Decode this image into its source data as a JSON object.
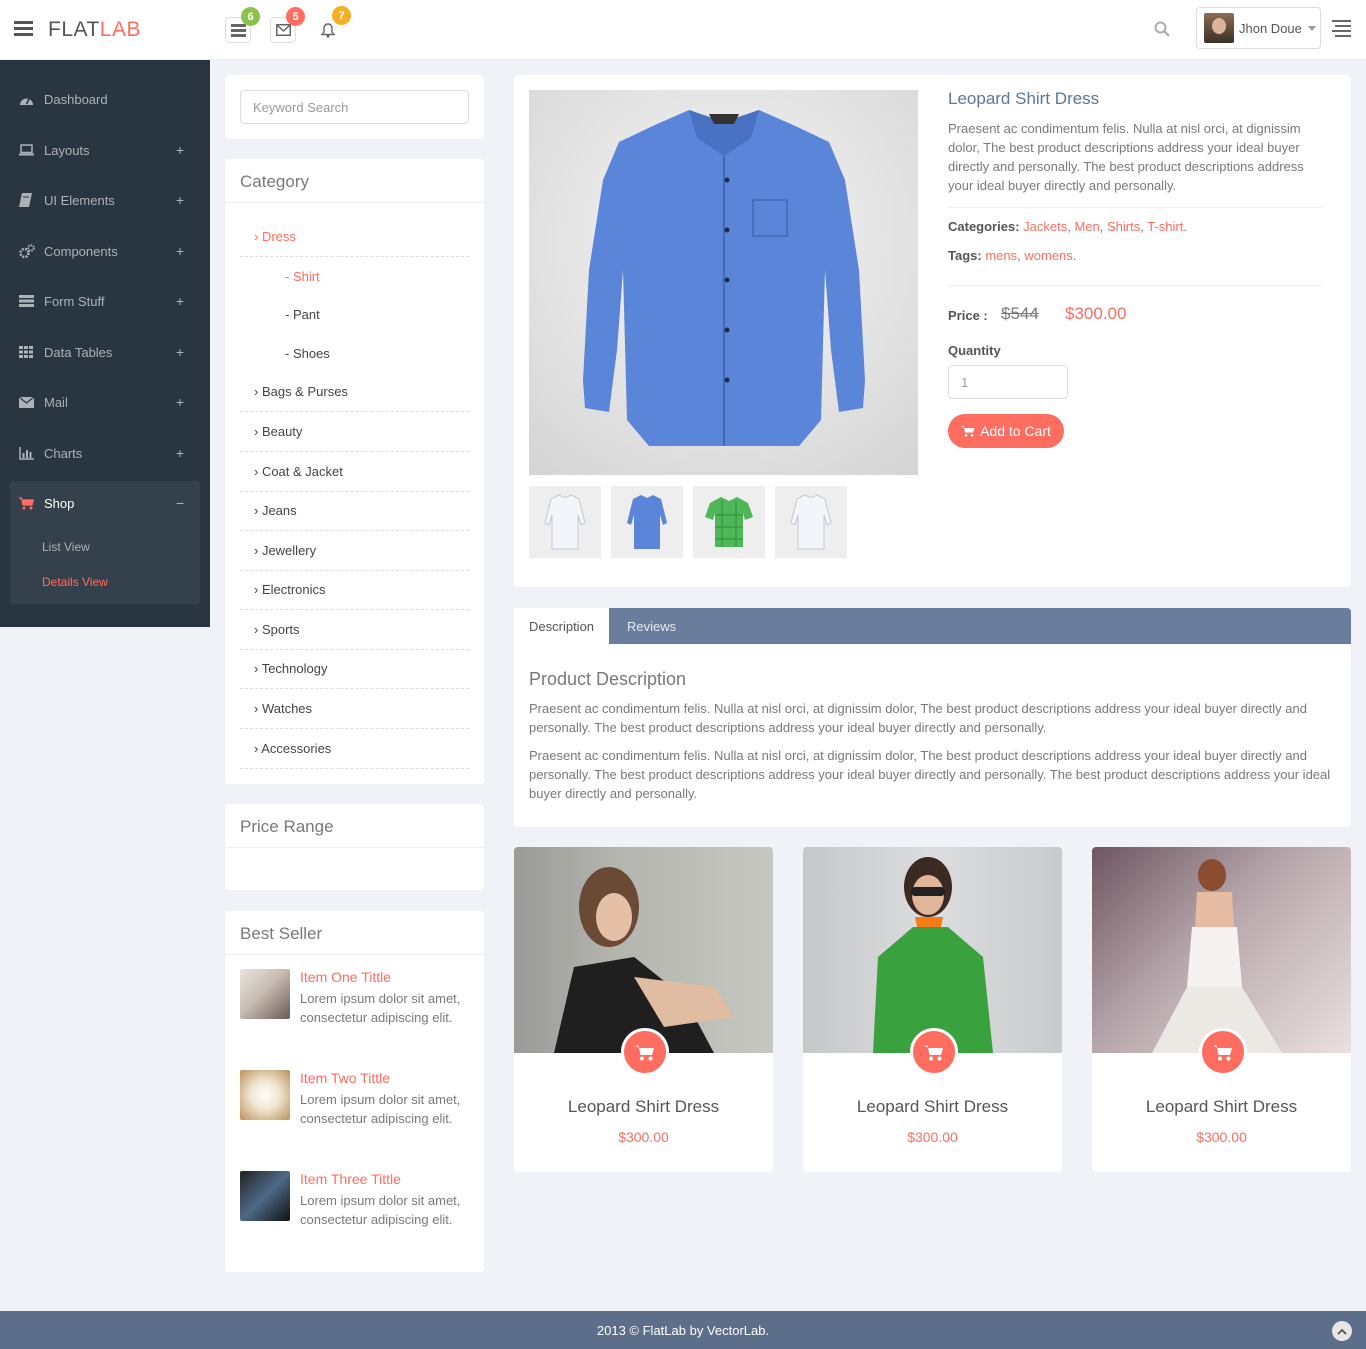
{
  "header": {
    "logo_main": "FLAT",
    "logo_accent": "LAB",
    "notifications": [
      {
        "icon": "tasks-icon",
        "count": "6",
        "color": "#8bc34a"
      },
      {
        "icon": "envelope-icon",
        "count": "5",
        "color": "#ff6c60"
      },
      {
        "icon": "bell-icon",
        "count": "7",
        "color": "#f5b021"
      }
    ],
    "user_name": "Jhon Doue"
  },
  "sidebar": {
    "items": [
      {
        "label": "Dashboard",
        "icon": "dashboard-icon",
        "expand": ""
      },
      {
        "label": "Layouts",
        "icon": "laptop-icon",
        "expand": "+"
      },
      {
        "label": "UI Elements",
        "icon": "book-icon",
        "expand": "+"
      },
      {
        "label": "Components",
        "icon": "cogs-icon",
        "expand": "+"
      },
      {
        "label": "Form Stuff",
        "icon": "tasks-icon",
        "expand": "+"
      },
      {
        "label": "Data Tables",
        "icon": "grid-icon",
        "expand": "+"
      },
      {
        "label": "Mail",
        "icon": "envelope-icon",
        "expand": "+"
      },
      {
        "label": "Charts",
        "icon": "bar-chart-icon",
        "expand": "+"
      },
      {
        "label": "Shop",
        "icon": "cart-icon",
        "expand": "−"
      }
    ],
    "sub_items": [
      {
        "label": "List View"
      },
      {
        "label": "Details View"
      }
    ],
    "accent": "#ff6c60"
  },
  "search": {
    "placeholder": "Keyword Search"
  },
  "category": {
    "title": "Category",
    "items": [
      {
        "label": "› Dress"
      },
      {
        "label": "- Shirt"
      },
      {
        "label": "- Pant"
      },
      {
        "label": "- Shoes"
      },
      {
        "label": "› Bags & Purses"
      },
      {
        "label": "› Beauty"
      },
      {
        "label": "› Coat & Jacket"
      },
      {
        "label": "› Jeans"
      },
      {
        "label": "› Jewellery"
      },
      {
        "label": "› Electronics"
      },
      {
        "label": "› Sports"
      },
      {
        "label": "› Technology"
      },
      {
        "label": "› Watches"
      },
      {
        "label": "› Accessories"
      }
    ]
  },
  "price_range": {
    "title": "Price Range"
  },
  "best_seller": {
    "title": "Best Seller",
    "items": [
      {
        "title": "Item One Tittle",
        "text": "Lorem ipsum dolor sit amet, consectetur adipiscing elit."
      },
      {
        "title": "Item Two Tittle",
        "text": "Lorem ipsum dolor sit amet, consectetur adipiscing elit."
      },
      {
        "title": "Item Three Tittle",
        "text": "Lorem ipsum dolor sit amet, consectetur adipiscing elit."
      }
    ]
  },
  "product": {
    "title": "Leopard Shirt Dress",
    "description": "Praesent ac condimentum felis. Nulla at nisl orci, at dignissim dolor, The best product descriptions address your ideal buyer directly and personally. The best product descriptions address your ideal buyer directly and personally.",
    "categories_label": "Categories:",
    "categories": [
      "Jackets",
      "Men",
      "Shirts",
      "T-shirt"
    ],
    "tags_label": "Tags:",
    "tags": [
      "mens",
      "womens"
    ],
    "price_label": "Price :",
    "old_price": "$544",
    "price": "$300.00",
    "quantity_label": "Quantity",
    "quantity_value": "1",
    "add_to_cart": "Add to Cart"
  },
  "tabs": {
    "description": "Description",
    "reviews": "Reviews"
  },
  "description_section": {
    "heading": "Product Description",
    "para1": "Praesent ac condimentum felis. Nulla at nisl orci, at dignissim dolor, The best product descriptions address your ideal buyer directly and personally. The best product descriptions address your ideal buyer directly and personally.",
    "para2": "Praesent ac condimentum felis. Nulla at nisl orci, at dignissim dolor, The best product descriptions address your ideal buyer directly and personally. The best product descriptions address your ideal buyer directly and personally. The best product descriptions address your ideal buyer directly and personally."
  },
  "related": [
    {
      "title": "Leopard Shirt Dress",
      "price": "$300.00"
    },
    {
      "title": "Leopard Shirt Dress",
      "price": "$300.00"
    },
    {
      "title": "Leopard Shirt Dress",
      "price": "$300.00"
    }
  ],
  "footer": {
    "text": "2013 © FlatLab by VectorLab."
  }
}
